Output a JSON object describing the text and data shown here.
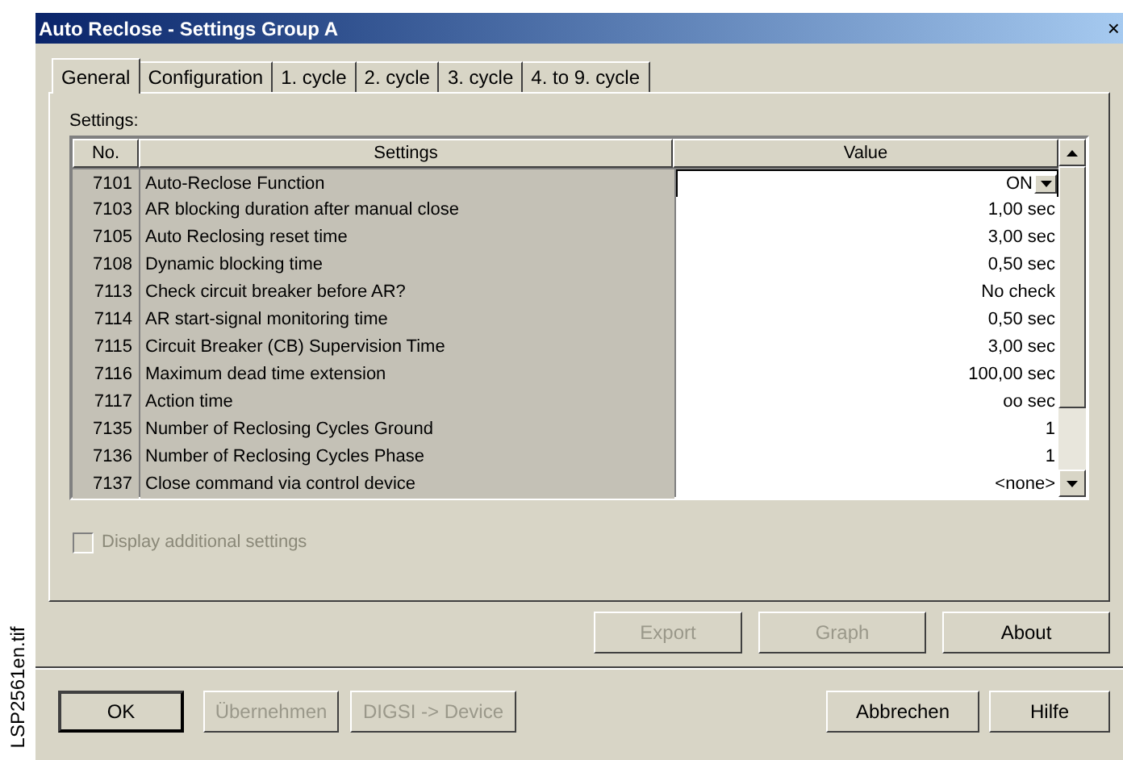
{
  "figure_label": "LSP2561en.tif",
  "window": {
    "title": "Auto Reclose - Settings Group A",
    "close": "×"
  },
  "tabs": [
    {
      "label": "General",
      "selected": true
    },
    {
      "label": "Configuration",
      "selected": false
    },
    {
      "label": "1. cycle",
      "selected": false
    },
    {
      "label": "2. cycle",
      "selected": false
    },
    {
      "label": "3. cycle",
      "selected": false
    },
    {
      "label": "4. to 9. cycle",
      "selected": false
    }
  ],
  "settings_label": "Settings:",
  "table": {
    "columns": [
      "No.",
      "Settings",
      "Value"
    ],
    "rows": [
      {
        "no": "7101",
        "setting": "Auto-Reclose Function",
        "value": "ON",
        "kind": "dropdown"
      },
      {
        "no": "7103",
        "setting": "AR blocking duration after manual close",
        "value": "1,00 sec",
        "kind": "text"
      },
      {
        "no": "7105",
        "setting": "Auto Reclosing reset time",
        "value": "3,00 sec",
        "kind": "text"
      },
      {
        "no": "7108",
        "setting": "Dynamic blocking time",
        "value": "0,50 sec",
        "kind": "text"
      },
      {
        "no": "7113",
        "setting": "Check circuit breaker before AR?",
        "value": "No check",
        "kind": "text"
      },
      {
        "no": "7114",
        "setting": "AR start-signal monitoring time",
        "value": "0,50 sec",
        "kind": "text"
      },
      {
        "no": "7115",
        "setting": "Circuit Breaker (CB) Supervision Time",
        "value": "3,00 sec",
        "kind": "text"
      },
      {
        "no": "7116",
        "setting": "Maximum dead time extension",
        "value": "100,00 sec",
        "kind": "text"
      },
      {
        "no": "7117",
        "setting": "Action time",
        "value": "oo sec",
        "kind": "text"
      },
      {
        "no": "7135",
        "setting": "Number of Reclosing Cycles Ground",
        "value": "1",
        "kind": "text"
      },
      {
        "no": "7136",
        "setting": "Number of Reclosing Cycles Phase",
        "value": "1",
        "kind": "text"
      },
      {
        "no": "7137",
        "setting": "Close command via control device",
        "value": "<none>",
        "kind": "text"
      }
    ]
  },
  "display_additional_settings": {
    "label": "Display additional settings",
    "checked": false,
    "disabled": true
  },
  "panel_buttons": [
    {
      "label": "Export",
      "disabled": true
    },
    {
      "label": "Graph",
      "disabled": true
    },
    {
      "label": "About",
      "disabled": false
    }
  ],
  "dialog_buttons": [
    {
      "label": "OK",
      "disabled": false,
      "default": true
    },
    {
      "label": "Übernehmen",
      "disabled": true,
      "default": false
    },
    {
      "label": "DIGSI -> Device",
      "disabled": true,
      "default": false
    },
    {
      "label": "Abbrechen",
      "disabled": false,
      "default": false
    },
    {
      "label": "Hilfe",
      "disabled": false,
      "default": false
    }
  ]
}
